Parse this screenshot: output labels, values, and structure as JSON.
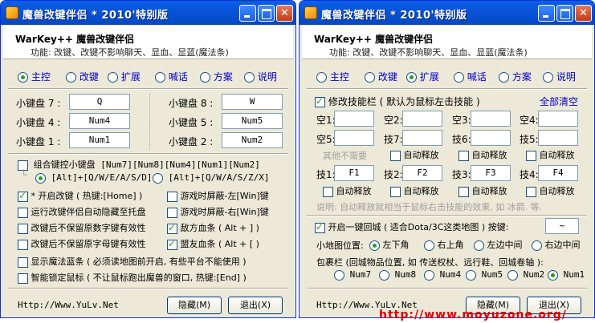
{
  "left": {
    "title": "魔兽改键伴侣 * 2010'特别版",
    "header_title": "WarKey++ 魔兽改键伴侣",
    "header_sub": "功能: 改键、改键不影响聊天、显血、显蓝(魔法条)",
    "tabs": [
      "主控",
      "改键",
      "扩展",
      "喊话",
      "方案",
      "说明"
    ],
    "active_tab": 0,
    "numpad": [
      {
        "label": "小键盘 7 :",
        "value": "Q"
      },
      {
        "label": "小键盘 8 :",
        "value": "W"
      },
      {
        "label": "小键盘 4 :",
        "value": "Num4"
      },
      {
        "label": "小键盘 5 :",
        "value": "Num5"
      },
      {
        "label": "小键盘 1 :",
        "value": "Num1"
      },
      {
        "label": "小键盘 2 :",
        "value": "Num2"
      }
    ],
    "combo_label": "组合键控小键盘 [Num7][Num8][Num4][Num1][Num2]",
    "combo_opt1": "[Alt]+[Q/W/E/A/S/D]",
    "combo_opt2": "[Alt]+[Q/W/A/S/Z/X]",
    "options": [
      {
        "label": "* 开启改键 ( 热键:[Home] )",
        "checked": true
      },
      {
        "label": "游戏时屏蔽-左[Win]键",
        "checked": false
      },
      {
        "label": "运行改键伴侣自动隐藏至托盘",
        "checked": false
      },
      {
        "label": "游戏时屏蔽-右[Win]键",
        "checked": false
      },
      {
        "label": "改键后不保留原数字键有效性",
        "checked": false
      },
      {
        "label": "敌方血条 ( Alt + ] )",
        "checked": true
      },
      {
        "label": "改键后不保留原字母键有效性",
        "checked": false
      },
      {
        "label": "盟友血条 ( Alt + [ )",
        "checked": true
      },
      {
        "label": "显示魔法蓝条 ( 必须读地图前开启, 有些平台不能使用 )",
        "checked": false
      },
      {
        "label": "智能锁定鼠标 ( 不让鼠标跑出魔兽的窗口, 热键:[End] )",
        "checked": false
      }
    ],
    "footer_url": "Http://Www.YuLv.Net",
    "hide_btn": "隐藏(M)",
    "exit_btn": "退出(X)"
  },
  "right": {
    "title": "魔兽改键伴侣 * 2010'特别版",
    "header_title": "WarKey++ 魔兽改键伴侣",
    "header_sub": "功能: 改键、改键不影响聊天、显血、显蓝(魔法条)",
    "tabs": [
      "主控",
      "改键",
      "扩展",
      "喊话",
      "方案",
      "说明"
    ],
    "active_tab": 2,
    "modify_label": "修改技能栏 ( 默认为鼠标左击技能 )",
    "clear_all": "全部清空",
    "slot_labels_row1": [
      "空1:",
      "空2:",
      "空3:",
      "空4:"
    ],
    "slot_labels_row2": [
      "空5:",
      "技7:",
      "技6:",
      "技5:"
    ],
    "not_needed": "其他不需要",
    "auto_release": "自动释放",
    "skill_labels": [
      "技1:",
      "技2:",
      "技3:",
      "技4:"
    ],
    "skill_values": [
      "F1",
      "F2",
      "F3",
      "F4"
    ],
    "note": "说明: 自动释放就相当于鼠标右击技能的效果, 如 冰箭. 等.",
    "return_label": "开启一键回城 ( 适合Dota/3C这类地图 ) 按键:",
    "return_key": "~",
    "minimap_label": "小地图位置:",
    "minimap_opts": [
      "左下角",
      "右上角",
      "左边中间",
      "右边中间"
    ],
    "bag_label": "包裹栏 (回城物品位置, 如 传送权杖、远行鞋、回城卷轴 ):",
    "bag_opts": [
      "Num7",
      "Num8",
      "Num4",
      "Num5",
      "Num2",
      "Num1"
    ],
    "footer_url": "Http://Www.YuLv.Net",
    "hide_btn": "隐藏(M)",
    "exit_btn": "退出(X)"
  },
  "watermark": "http://www.moyuzone.org/"
}
